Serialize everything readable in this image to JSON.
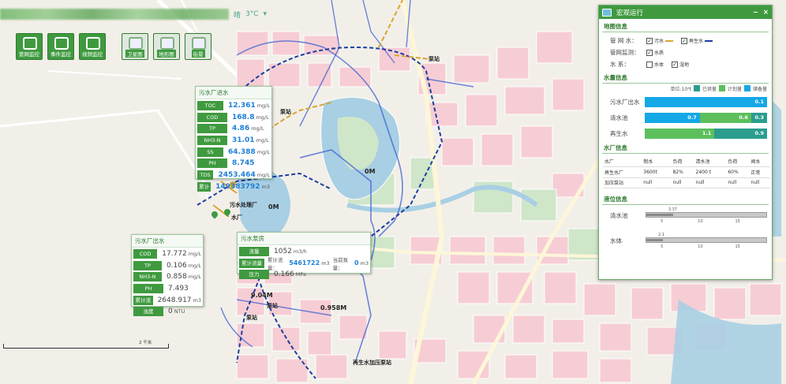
{
  "weather": {
    "prefix": "晴",
    "temp": "3°C",
    "arrow": "▾"
  },
  "toolbar": [
    {
      "label": "管网监控",
      "icon": "network-icon"
    },
    {
      "label": "事件监控",
      "icon": "camera-icon"
    },
    {
      "label": "视频监控",
      "icon": "video-icon"
    },
    {
      "label": "卫星图",
      "icon": "satellite-map-icon"
    },
    {
      "label": "地形图",
      "icon": "terrain-map-icon"
    },
    {
      "label": "街景",
      "icon": "street-map-icon"
    }
  ],
  "sewage_box": {
    "title": "污水厂进水",
    "rows": [
      {
        "k": "TOC",
        "v": "12.361",
        "u": "mg/L"
      },
      {
        "k": "COD",
        "v": "168.8",
        "u": "mg/L"
      },
      {
        "k": "TP",
        "v": "4.86",
        "u": "mg/L"
      },
      {
        "k": "NH3-N",
        "v": "31.01",
        "u": "mg/L"
      },
      {
        "k": "SS",
        "v": "64.388",
        "u": "mg/L"
      },
      {
        "k": "PH",
        "v": "8.745",
        "u": ""
      },
      {
        "k": "TDS",
        "v": "2453.464",
        "u": "mg/L"
      },
      {
        "k": "累计流量",
        "v": "149383792",
        "u": "m3"
      }
    ]
  },
  "outflow_box": {
    "title": "污水厂出水",
    "rows": [
      {
        "k": "COD",
        "v": "17.772",
        "u": "mg/L"
      },
      {
        "k": "TP",
        "v": "0.106",
        "u": "mg/L"
      },
      {
        "k": "NH3-N",
        "v": "0.858",
        "u": "mg/L"
      },
      {
        "k": "PH",
        "v": "7.493",
        "u": ""
      },
      {
        "k": "累计流量",
        "v": "2648.917",
        "u": "m3"
      },
      {
        "k": "浊度",
        "v": "0",
        "u": "NTU"
      }
    ]
  },
  "pump_box": {
    "title": "污水泵房",
    "flow_k": "流量",
    "flow_v": "1052",
    "flow_u": "m3/h",
    "acc_k": "累计流量",
    "acc_text": "累计流量：",
    "acc_v": "5461722",
    "acc_u": "m3",
    "cur_text": "当前泵量：",
    "cur_v": "0",
    "cur_u": "m3",
    "press_k": "压力",
    "press_v": "0.166",
    "press_u": "MPa"
  },
  "map_labels": {
    "pump1": "泵站",
    "pump2": "泵站",
    "plant": "污水处理厂",
    "waterworks": "水厂",
    "l0m1": "0M",
    "l0m2": "0M",
    "l904": "9.04M",
    "l0958": "0.958M",
    "pump3": "泵站",
    "pump4": "泵站",
    "reuse": "再生水加压泵站",
    "scale": "2 千米"
  },
  "panel": {
    "title": "宏观运行",
    "min": "−",
    "close": "×",
    "layer_section": "地图信息",
    "pipe_label": "管  网  水：",
    "pipe_opts": [
      {
        "label": "污水",
        "checked": "✓",
        "color": "#d9a431"
      },
      {
        "label": "再生水",
        "checked": "✓",
        "color": "#1c3f9f"
      }
    ],
    "monitor_label": "管网监测：",
    "monitor_opts": [
      {
        "label": "水质",
        "checked": "✓"
      }
    ],
    "water_label": "水        系：",
    "water_opts": [
      {
        "label": "水体",
        "checked": ""
      },
      {
        "label": "湿地",
        "checked": "✓"
      }
    ],
    "volume_section": "水量信息",
    "unit": "单位:10⁴t",
    "legend": [
      {
        "label": "已供量",
        "color": "#2a9d8f"
      },
      {
        "label": "计划量",
        "color": "#5cbf5c"
      },
      {
        "label": "储备量",
        "color": "#14a8e6"
      }
    ],
    "bars": [
      {
        "label": "污水厂出水",
        "segments": [
          {
            "value": "0.1",
            "share": 1.0,
            "color": "#14a8e6"
          }
        ]
      },
      {
        "label": "清水池",
        "segments": [
          {
            "value": "0.7",
            "share": 0.45,
            "color": "#14a8e6"
          },
          {
            "value": "0.6",
            "share": 0.42,
            "color": "#5cbf5c"
          },
          {
            "value": "0.3",
            "share": 0.13,
            "color": "#2a9d8f"
          }
        ]
      },
      {
        "label": "再生水",
        "segments": [
          {
            "value": "1.1",
            "share": 0.57,
            "color": "#5cbf5c"
          },
          {
            "value": "0.9",
            "share": 0.43,
            "color": "#2a9d8f"
          }
        ]
      }
    ],
    "plant_section": "水厂信息",
    "table_header": [
      "水厂",
      "制水",
      "负荷",
      "清水池",
      "负荷",
      "阀水"
    ],
    "table_rows": [
      [
        "再生水厂",
        "3600t",
        "82%",
        "2400 t",
        "60%",
        "正常"
      ],
      [
        "加压泵站",
        "null",
        "null",
        "null",
        "null",
        "null"
      ]
    ],
    "level_section": "液位信息",
    "levels": [
      {
        "label": "清水池",
        "value": "3.37",
        "fraction": 0.224
      },
      {
        "label": "水体",
        "value": "2.1",
        "fraction": 0.14
      }
    ],
    "ticks": [
      "5",
      "10",
      "15"
    ]
  }
}
